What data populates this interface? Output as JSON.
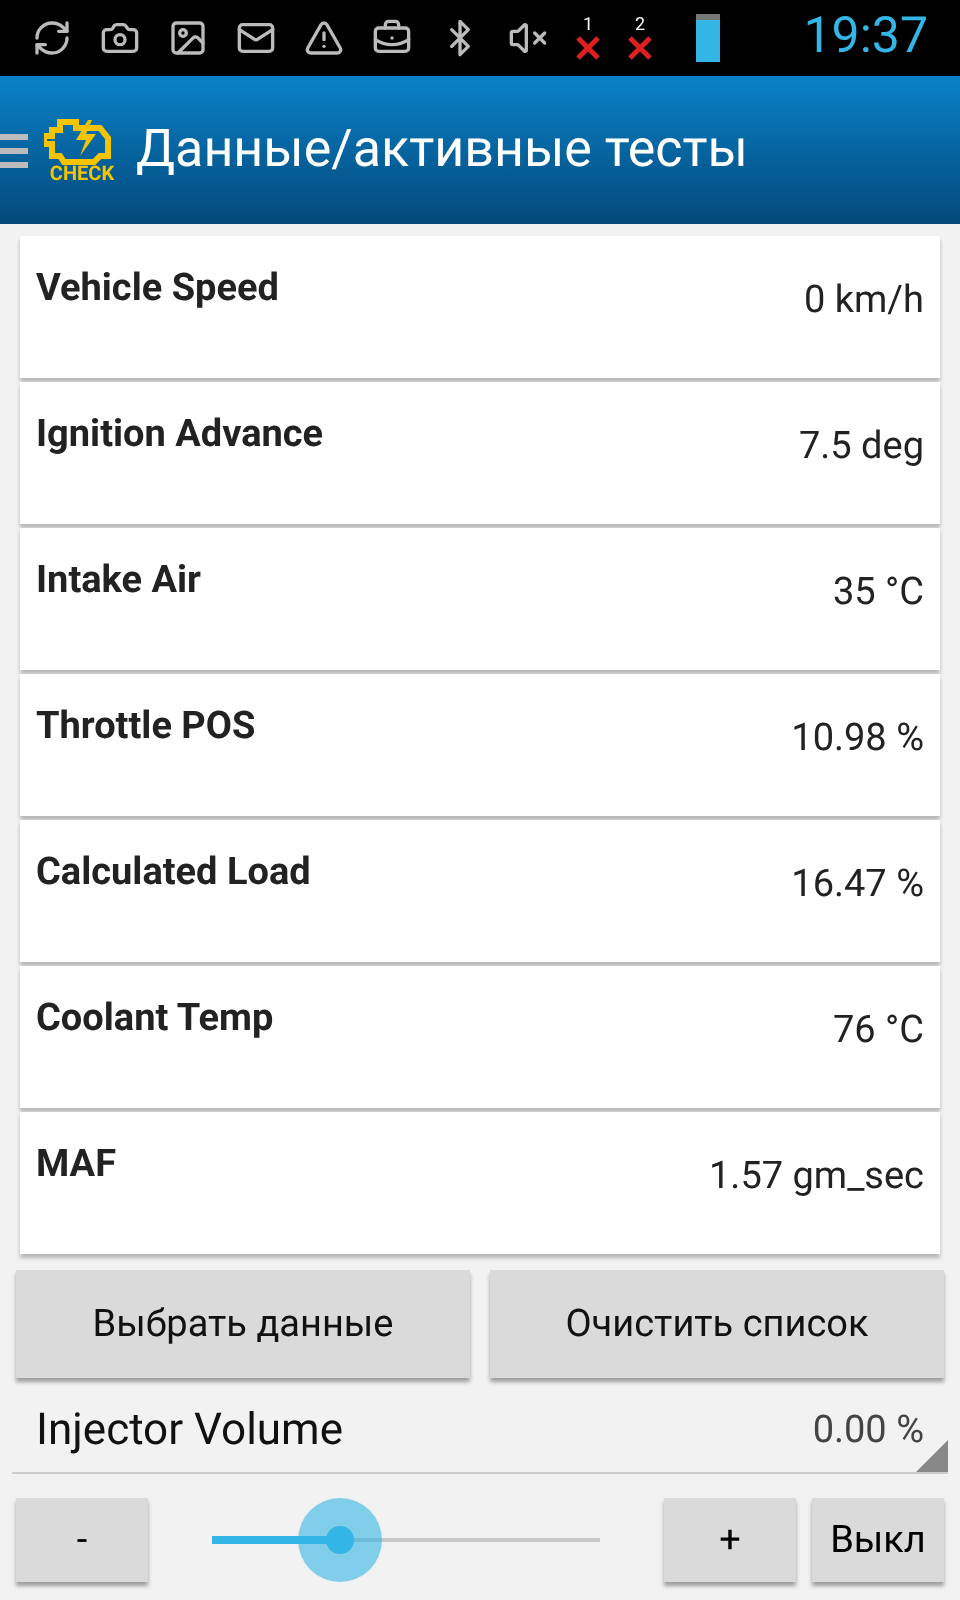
{
  "status_bar": {
    "sim_indicators": [
      {
        "label": "1"
      },
      {
        "label": "2"
      }
    ],
    "time": "19:37"
  },
  "header": {
    "title": "Данные/активные тесты",
    "logo_text": "CHECK"
  },
  "readings": [
    {
      "name": "Vehicle Speed",
      "value": "0 km/h"
    },
    {
      "name": "Ignition Advance",
      "value": "7.5 deg"
    },
    {
      "name": "Intake Air",
      "value": "35 °C"
    },
    {
      "name": "Throttle POS",
      "value": "10.98 %"
    },
    {
      "name": "Calculated Load",
      "value": "16.47 %"
    },
    {
      "name": "Coolant Temp",
      "value": "76 °C"
    },
    {
      "name": "MAF",
      "value": "1.57 gm_sec"
    }
  ],
  "buttons": [
    "Выбрать данные",
    "Очистить список"
  ],
  "active_test": {
    "name": "Injector Volume",
    "value": "0.00 %",
    "level": 0.33,
    "minus": "-",
    "plus": "+",
    "off": "Выкл"
  }
}
